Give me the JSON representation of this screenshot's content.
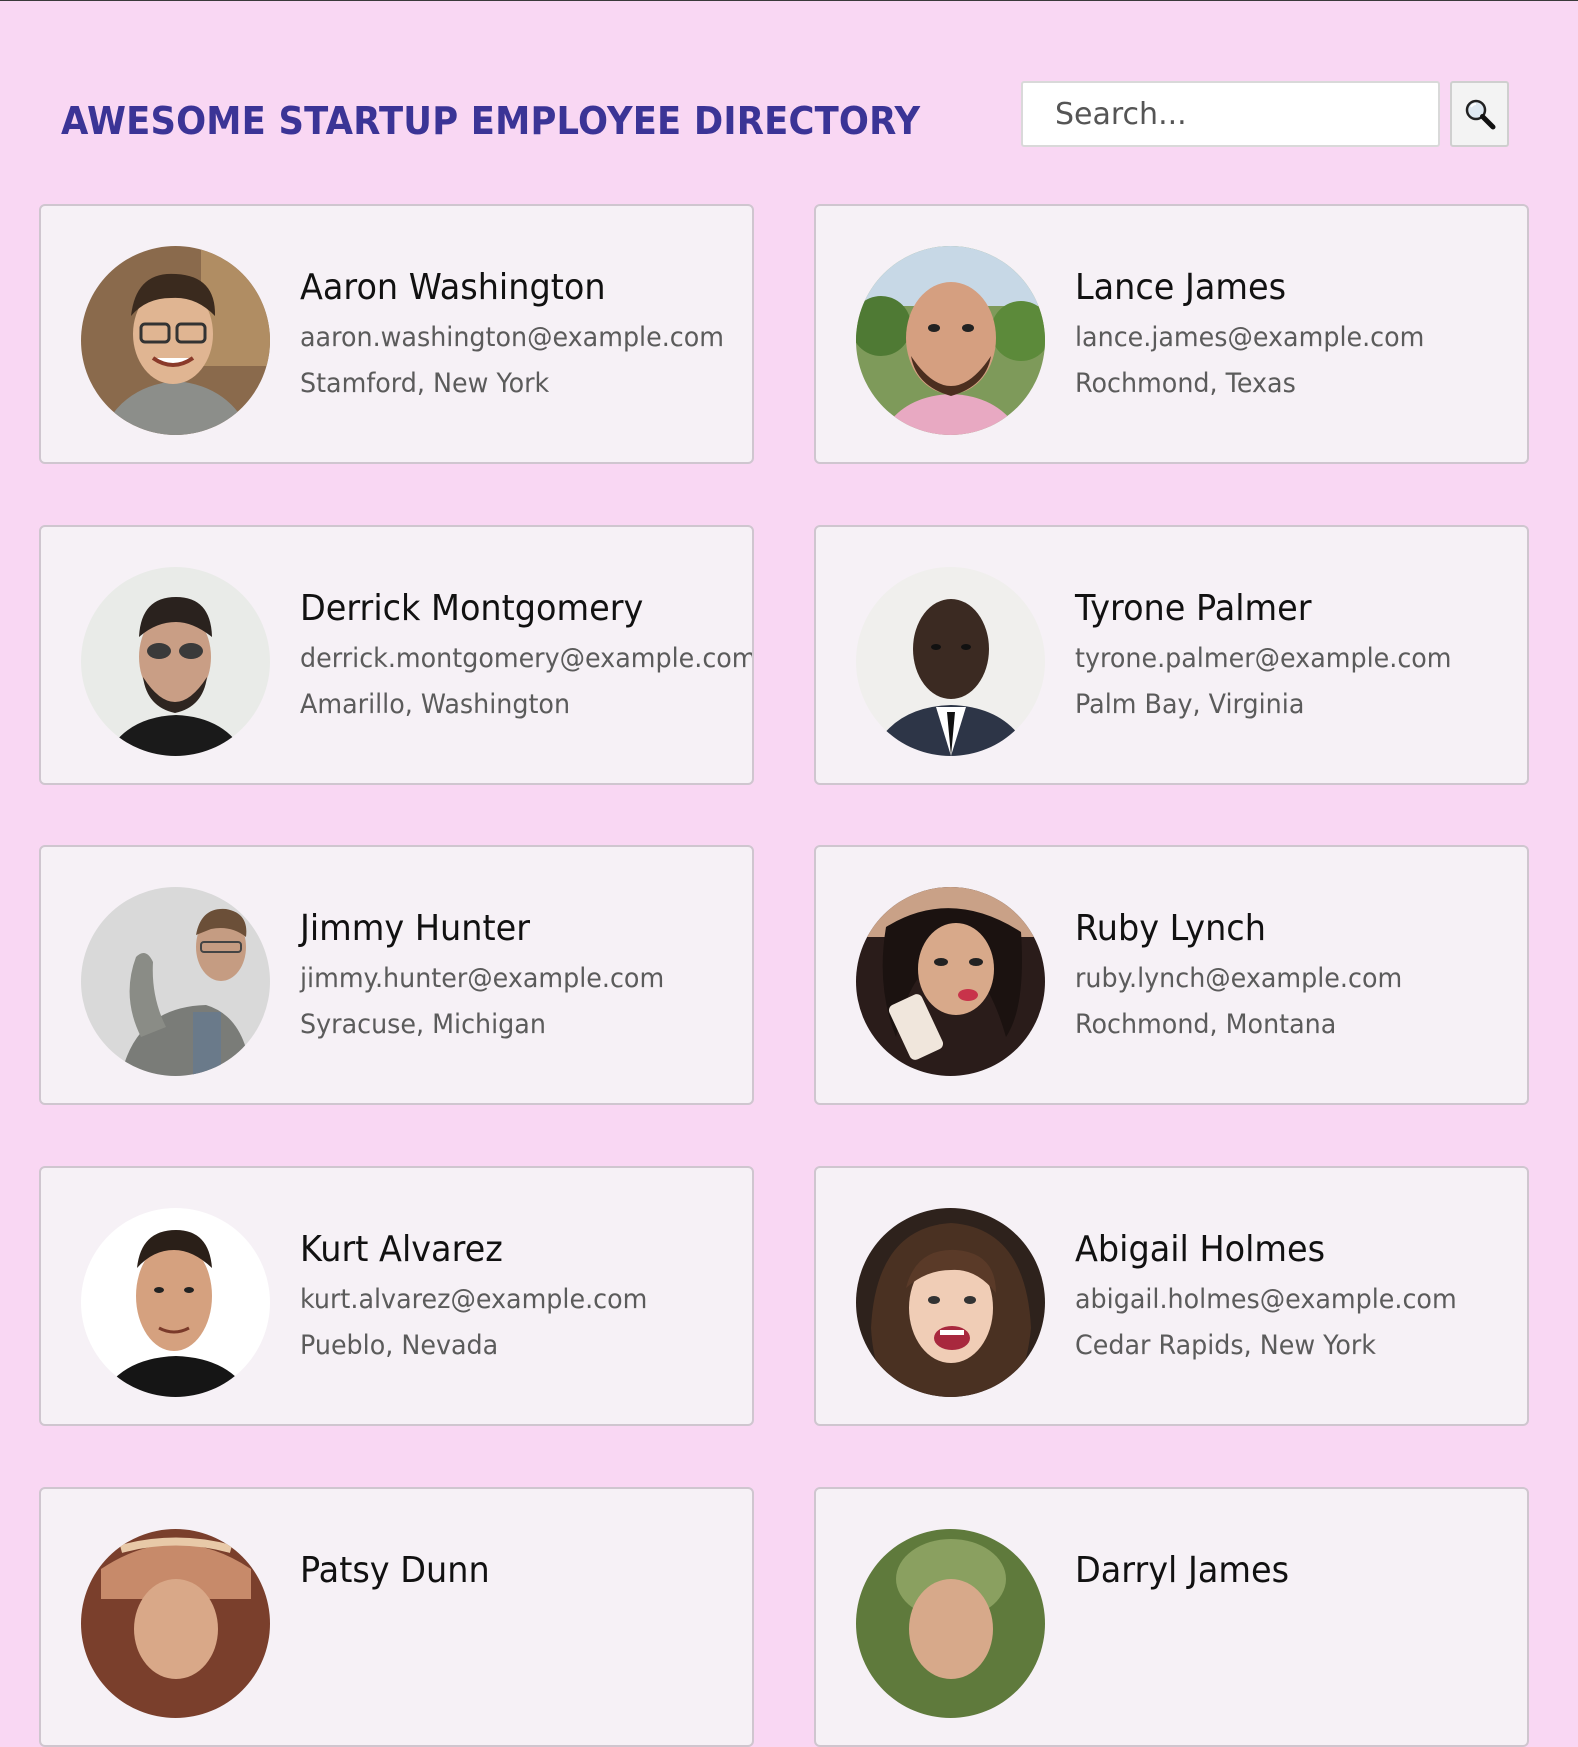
{
  "header": {
    "title": "AWESOME STARTUP EMPLOYEE DIRECTORY",
    "search_placeholder": "Search...",
    "search_icon": "magnifier-icon"
  },
  "colors": {
    "page_background": "#f9d7f3",
    "title": "#3b3496",
    "card_background": "#f6f1f6",
    "card_border": "#cfc6cf"
  },
  "employees": [
    {
      "name": "Aaron Washington",
      "email": "aaron.washington@example.com",
      "location": "Stamford, New York"
    },
    {
      "name": "Lance James",
      "email": "lance.james@example.com",
      "location": "Rochmond, Texas"
    },
    {
      "name": "Derrick Montgomery",
      "email": "derrick.montgomery@example.com",
      "location": "Amarillo, Washington"
    },
    {
      "name": "Tyrone Palmer",
      "email": "tyrone.palmer@example.com",
      "location": "Palm Bay, Virginia"
    },
    {
      "name": "Jimmy Hunter",
      "email": "jimmy.hunter@example.com",
      "location": "Syracuse, Michigan"
    },
    {
      "name": "Ruby Lynch",
      "email": "ruby.lynch@example.com",
      "location": "Rochmond, Montana"
    },
    {
      "name": "Kurt Alvarez",
      "email": "kurt.alvarez@example.com",
      "location": "Pueblo, Nevada"
    },
    {
      "name": "Abigail Holmes",
      "email": "abigail.holmes@example.com",
      "location": "Cedar Rapids, New York"
    },
    {
      "name": "Patsy Dunn",
      "email": "",
      "location": ""
    },
    {
      "name": "Darryl James",
      "email": "",
      "location": ""
    }
  ]
}
